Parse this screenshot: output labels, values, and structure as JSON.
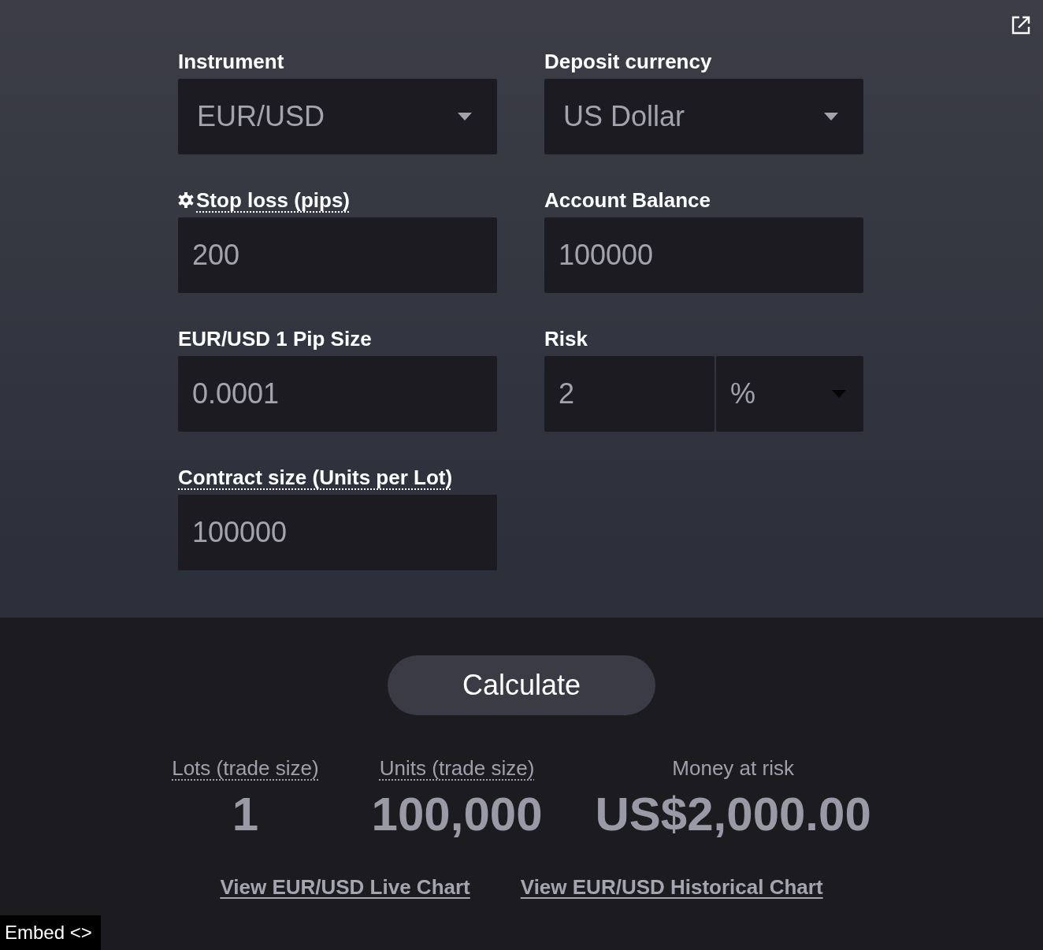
{
  "fields": [
    {
      "kind": "select",
      "label": "Instrument",
      "value": "EUR/USD",
      "settings": false,
      "has_tooltip": false
    },
    {
      "kind": "select",
      "label": "Deposit currency",
      "value": "US Dollar",
      "settings": false,
      "has_tooltip": false
    },
    {
      "kind": "input",
      "label": "Stop loss (pips)",
      "value": "200",
      "settings": true,
      "has_tooltip": true
    },
    {
      "kind": "input",
      "label": "Account Balance",
      "value": "100000",
      "settings": false,
      "has_tooltip": false
    },
    {
      "kind": "input",
      "label": "EUR/USD 1 Pip Size",
      "value": "0.0001",
      "settings": false,
      "has_tooltip": false
    },
    {
      "kind": "input_with_unit",
      "label": "Risk",
      "value": "2",
      "unit": "%",
      "settings": false,
      "has_tooltip": false
    },
    {
      "kind": "input",
      "label": "Contract size (Units per Lot)",
      "value": "100000",
      "settings": false,
      "has_tooltip": true
    }
  ],
  "calculate_button": {
    "label": "Calculate"
  },
  "results": [
    {
      "label": "Lots (trade size)",
      "value": "1",
      "has_tooltip": true
    },
    {
      "label": "Units (trade size)",
      "value": "100,000",
      "has_tooltip": true
    },
    {
      "label": "Money at risk",
      "value": "US$2,000.00",
      "has_tooltip": false
    }
  ],
  "links": [
    "View EUR/USD Live Chart",
    "View EUR/USD Historical Chart"
  ],
  "embed_button": {
    "label": "Embed <>"
  }
}
